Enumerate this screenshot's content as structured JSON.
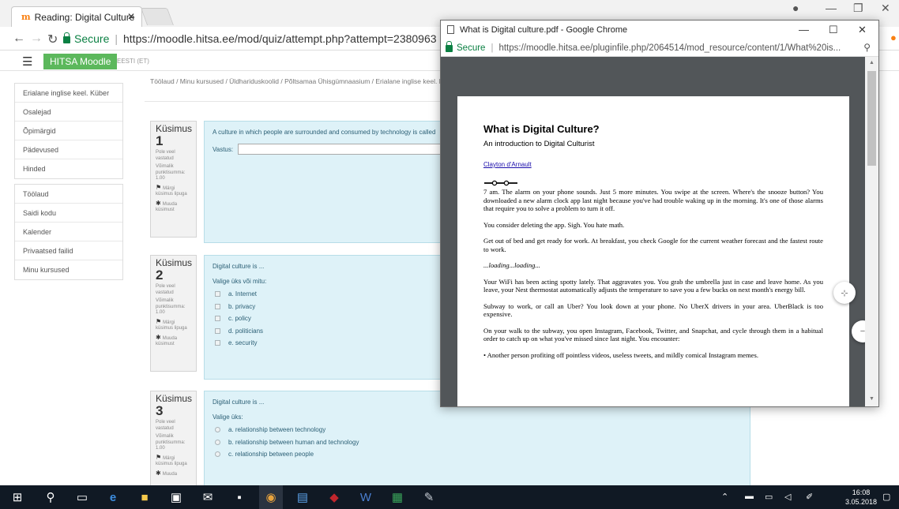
{
  "browser": {
    "tab_title": "Reading: Digital Culture",
    "tab_favicon": "m",
    "url_secure": "Secure",
    "url": "https://moodle.hitsa.ee/mod/quiz/attempt.php?attempt=2380963"
  },
  "moodle": {
    "brand": "HITSA Moodle",
    "language": "EESTI (ET)",
    "breadcrumb": "Töölaud / Minu kursused / Üldhariduskoolid / Põltsamaa Ühisgümnaasium / Erialane inglise keel. Kü",
    "sidebar_groups": [
      [
        "Erialane inglise keel. Küber",
        "Osalejad",
        "Õpimärgid",
        "Pädevused",
        "Hinded"
      ],
      [
        "Töölaud",
        "Saidi kodu",
        "Kalender",
        "Privaatsed failid",
        "Minu kursused"
      ]
    ]
  },
  "questions": [
    {
      "label": "Küsimus",
      "number": "1",
      "status": "Pole veel vastatud",
      "points": "Võimalik punktisumma: 1.00",
      "flag": "Märgi küsimus lipuga",
      "edit": "Muuda küsimust",
      "text": "A culture in which people are surrounded and consumed by technology is called",
      "answer_label": "Vastus:"
    },
    {
      "label": "Küsimus",
      "number": "2",
      "status": "Pole veel vastatud",
      "points": "Võimalik punktisumma: 1.00",
      "flag": "Märgi küsimus lipuga",
      "edit": "Muuda küsimust",
      "text": "Digital culture is ...",
      "prompt": "Valige üks või mitu:",
      "options": [
        "a. Internet",
        "b. privacy",
        "c. policy",
        "d. politicians",
        "e. security"
      ]
    },
    {
      "label": "Küsimus",
      "number": "3",
      "status": "Pole veel vastatud",
      "points": "Võimalik punktisumma: 1.00",
      "flag": "Märgi küsimus lipuga",
      "edit": "Muuda",
      "text": "Digital culture is ...",
      "prompt": "Valige üks:",
      "options": [
        "a. relationship between technology",
        "b. relationship between human and technology",
        "c. relationship between people"
      ]
    }
  ],
  "popup": {
    "title": "What is Digital culture.pdf - Google Chrome",
    "secure": "Secure",
    "url": "https://moodle.hitsa.ee/pluginfile.php/2064514/mod_resource/content/1/What%20is...",
    "pdf": {
      "title": "What is Digital Culture?",
      "subtitle": "An introduction to Digital Culturist",
      "author": "Clayton d'Arnault",
      "paragraphs": [
        "7 am. The alarm on your phone sounds. Just 5 more minutes. You swipe at the screen. Where's the snooze button? You downloaded a new alarm clock app last night because you've had trouble waking up in the morning. It's one of those alarms that require you to solve a problem to turn it off.",
        "You consider deleting the app. Sigh. You hate math.",
        "Get out of bed and get ready for work. At breakfast, you check Google for the current weather forecast and the fastest route to work.",
        "...loading...loading...",
        "Your WiFi has been acting spotty lately. That aggravates you. You grab the umbrella just in case and leave home. As you leave, your Nest thermostat automatically adjusts the temperature to save you a few bucks on next month's energy bill.",
        "Subway to work, or call an Uber? You look down at your phone. No UberX drivers in your area. UberBlack is too expensive.",
        "On your walk to the subway, you open Instagram, Facebook, Twitter, and Snapchat, and cycle through them in a habitual order to catch up on what you've missed since last night. You encounter:",
        "•      Another person profiting off pointless videos, useless tweets, and mildly comical Instagram memes."
      ]
    }
  },
  "taskbar": {
    "time": "16:08",
    "date": "3.05.2018"
  }
}
